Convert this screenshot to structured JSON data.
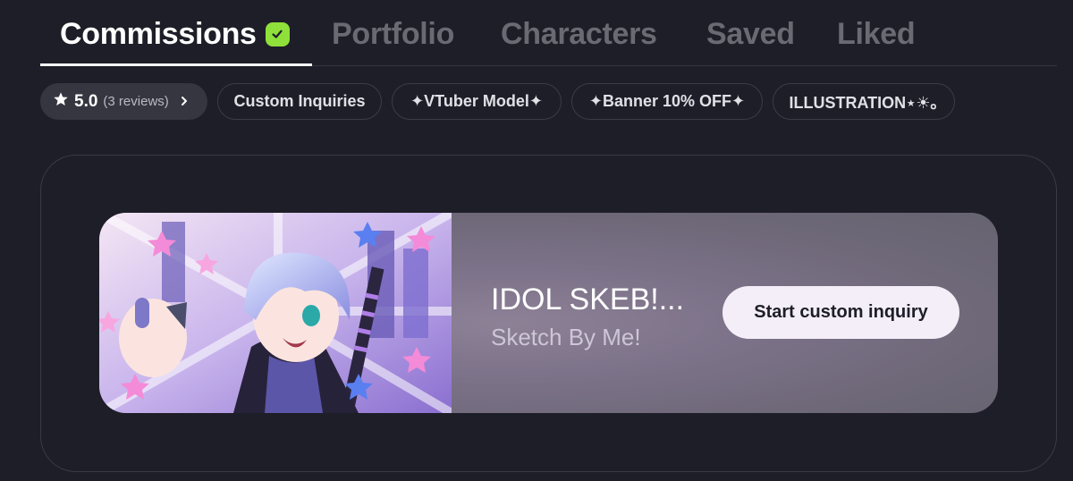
{
  "tabs": [
    {
      "label": "Commissions",
      "active": true,
      "verified": true
    },
    {
      "label": "Portfolio",
      "active": false
    },
    {
      "label": "Characters",
      "active": false
    },
    {
      "label": "Saved",
      "active": false
    },
    {
      "label": "Liked",
      "active": false
    }
  ],
  "rating": {
    "score": "5.0",
    "reviews": "(3 reviews)"
  },
  "chips": [
    "Custom Inquiries",
    "✦VTuber Model✦",
    "✦Banner 10% OFF✦",
    "ILLUSTRATION⋆☀︎｡"
  ],
  "banner": {
    "title": "IDOL SKEB!...",
    "subtitle": "Sketch By Me!",
    "button_label": "Start custom inquiry"
  },
  "colors": {
    "background": "#1e1e28",
    "verified_badge": "#8fe03a",
    "button_bg": "#f3eef8"
  }
}
